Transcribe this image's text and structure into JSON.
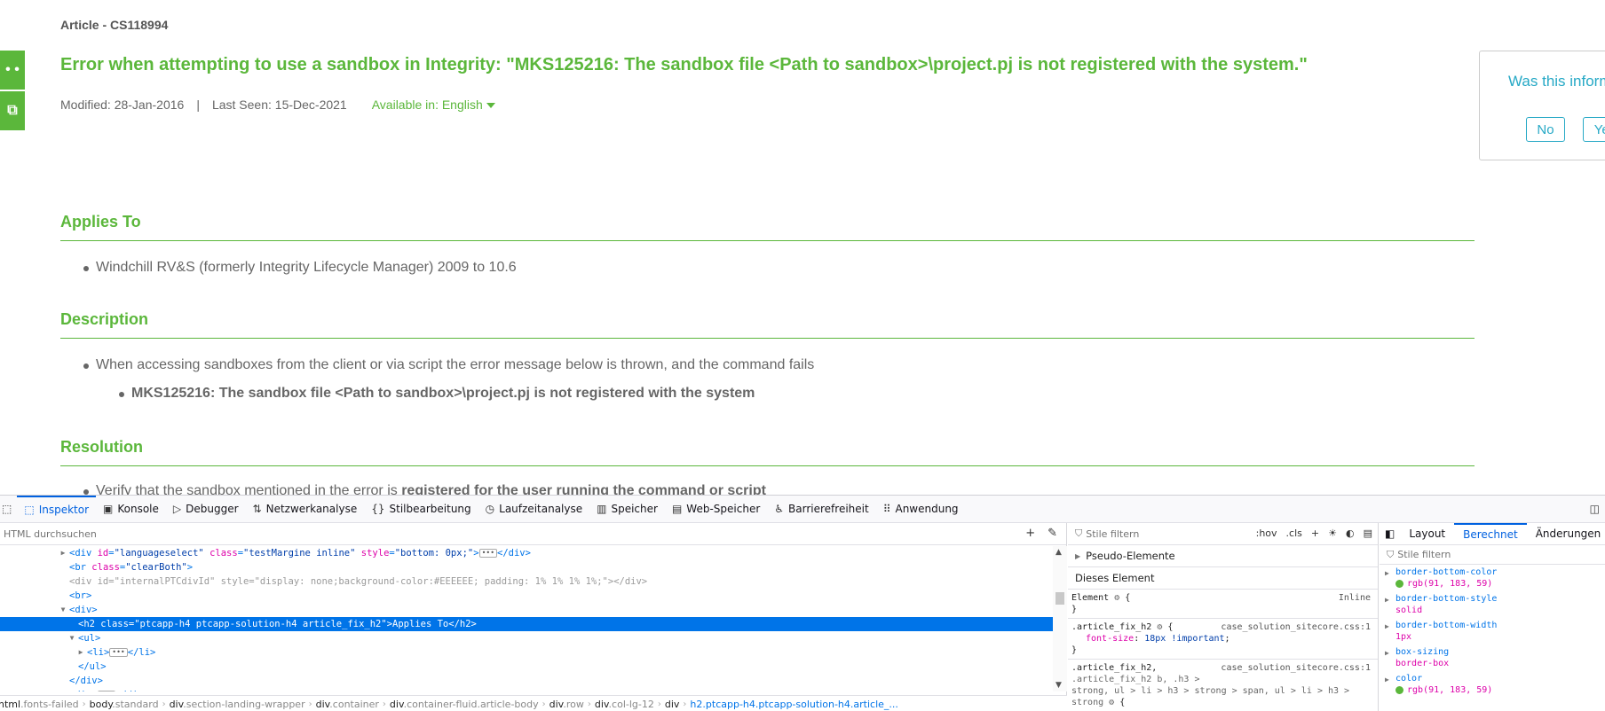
{
  "colors": {
    "brand_green": "#5bb73b",
    "feedback_teal": "#27a9c6",
    "devtools_blue": "#0074e8"
  },
  "side_buttons": [
    {
      "icon": "more-dots-icon",
      "glyph": "• •"
    },
    {
      "icon": "chat-icon",
      "glyph": "⧉"
    }
  ],
  "article": {
    "label": "Article - CS118994",
    "title": "Error when attempting to use a sandbox in Integrity: \"MKS125216: The sandbox file <Path to sandbox>\\project.pj is not registered with the system.\"",
    "modified": "Modified: 28-Jan-2016",
    "separator": "|",
    "last_seen": "Last Seen: 15-Dec-2021",
    "available_in": "Available in: English"
  },
  "feedback": {
    "question": "Was this information helpful?",
    "no": "No",
    "yes": "Yes"
  },
  "sections": {
    "applies_to": {
      "heading": "Applies To",
      "items": [
        "Windchill RV&S (formerly Integrity Lifecycle Manager) 2009 to 10.6"
      ]
    },
    "description": {
      "heading": "Description",
      "item": "When accessing sandboxes from the client or via script the error message below is thrown, and the command fails",
      "subitem": "MKS125216: The sandbox file <Path to sandbox>\\project.pj is not registered with the system"
    },
    "resolution": {
      "heading": "Resolution",
      "item_prefix": "Verify that the sandbox mentioned in the error is ",
      "item_bold": "registered for the user running the command or script"
    }
  },
  "devtools": {
    "tabs": [
      {
        "label": "Inspektor",
        "icon": "inspector-icon",
        "glyph": "⬚",
        "active": true
      },
      {
        "label": "Konsole",
        "icon": "console-icon",
        "glyph": "▣",
        "active": false
      },
      {
        "label": "Debugger",
        "icon": "debugger-icon",
        "glyph": "▷",
        "active": false
      },
      {
        "label": "Netzwerkanalyse",
        "icon": "network-icon",
        "glyph": "⇅",
        "active": false
      },
      {
        "label": "Stilbearbeitung",
        "icon": "style-editor-icon",
        "glyph": "{}",
        "active": false
      },
      {
        "label": "Laufzeitanalyse",
        "icon": "performance-icon",
        "glyph": "◷",
        "active": false
      },
      {
        "label": "Speicher",
        "icon": "memory-icon",
        "glyph": "▥",
        "active": false
      },
      {
        "label": "Web-Speicher",
        "icon": "storage-icon",
        "glyph": "▤",
        "active": false
      },
      {
        "label": "Barrierefreiheit",
        "icon": "accessibility-icon",
        "glyph": "♿",
        "active": false
      },
      {
        "label": "Anwendung",
        "icon": "application-icon",
        "glyph": "⠿",
        "active": false
      }
    ],
    "search_placeholder": "HTML durchsuchen",
    "breadcrumbs": [
      {
        "tag": "html",
        "cls": ".fonts-failed"
      },
      {
        "tag": "body",
        "cls": ".standard"
      },
      {
        "tag": "div",
        "cls": ".section-landing-wrapper"
      },
      {
        "tag": "div",
        "cls": ".container"
      },
      {
        "tag": "div",
        "cls": ".container-fluid.article-body"
      },
      {
        "tag": "div",
        "cls": ".row"
      },
      {
        "tag": "div",
        "cls": ".col-lg-12"
      },
      {
        "tag": "div",
        "cls": ""
      },
      {
        "tag": "h2",
        "cls": ".ptcapp-h4.ptcapp-solution-h4.article_..."
      }
    ],
    "rules": {
      "filter_placeholder": "Stile filtern",
      "hov": ":hov",
      "cls": ".cls",
      "pseudo": "Pseudo-Elemente",
      "this_element": "Dieses Element",
      "element_rule": "Element",
      "inline": "Inline",
      "rule1_selector": ".article_fix_h2",
      "rule1_source": "case_solution_sitecore.css:1",
      "rule1_prop": "font-size",
      "rule1_value": "18px !important",
      "rule2_selector": ".article_fix_h2,",
      "rule2_source": "case_solution_sitecore.css:1",
      "rule2_more1": ".article_fix_h2 b, .h3 >",
      "rule2_more2": "strong, ul > li > h3 > strong > span, ul > li > h3 >",
      "rule2_more3": "strong"
    },
    "computed": {
      "tabs": [
        "Layout",
        "Berechnet",
        "Änderungen"
      ],
      "active_tab": "Berechnet",
      "filter_placeholder": "Stile filtern",
      "props": [
        {
          "name": "border-bottom-color",
          "value": "rgb(91, 183, 59)",
          "swatch": true
        },
        {
          "name": "border-bottom-style",
          "value": "solid",
          "swatch": false
        },
        {
          "name": "border-bottom-width",
          "value": "1px",
          "swatch": false
        },
        {
          "name": "box-sizing",
          "value": "border-box",
          "swatch": false
        },
        {
          "name": "color",
          "value": "rgb(91, 183, 59)",
          "swatch": true
        }
      ]
    }
  }
}
